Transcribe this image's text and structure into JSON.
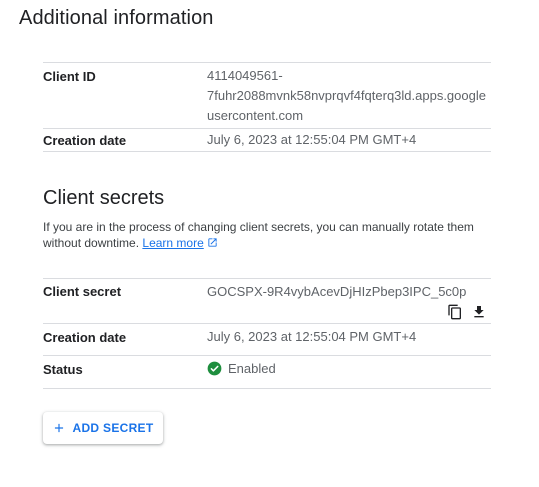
{
  "additional_info": {
    "title": "Additional information",
    "client_id_label": "Client ID",
    "client_id_line1": "4114049561-",
    "client_id_line2": "7fuhr2088mvnk58nvprqvf4fqterq3ld.apps.google",
    "client_id_line3": "usercontent.com",
    "creation_date_label": "Creation date",
    "creation_date_value": "July 6, 2023 at 12:55:04 PM GMT+4"
  },
  "client_secrets": {
    "title": "Client secrets",
    "description": "If you are in the process of changing client secrets, you can manually rotate them without downtime.",
    "learn_more": "Learn more",
    "secret_label": "Client secret",
    "secret_value": "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",
    "creation_date_label": "Creation date",
    "creation_date_value": "July 6, 2023 at 12:55:04 PM GMT+4",
    "status_label": "Status",
    "status_value": "Enabled",
    "add_secret_label": "ADD SECRET"
  },
  "icons": {
    "copy": "content-copy-icon",
    "download": "download-icon",
    "status": "check-circle-icon",
    "external": "open-in-new-icon",
    "add": "plus-icon"
  },
  "colors": {
    "accent": "#1a73e8",
    "enabled": "#1e8e3e",
    "divider": "#dadce0"
  }
}
